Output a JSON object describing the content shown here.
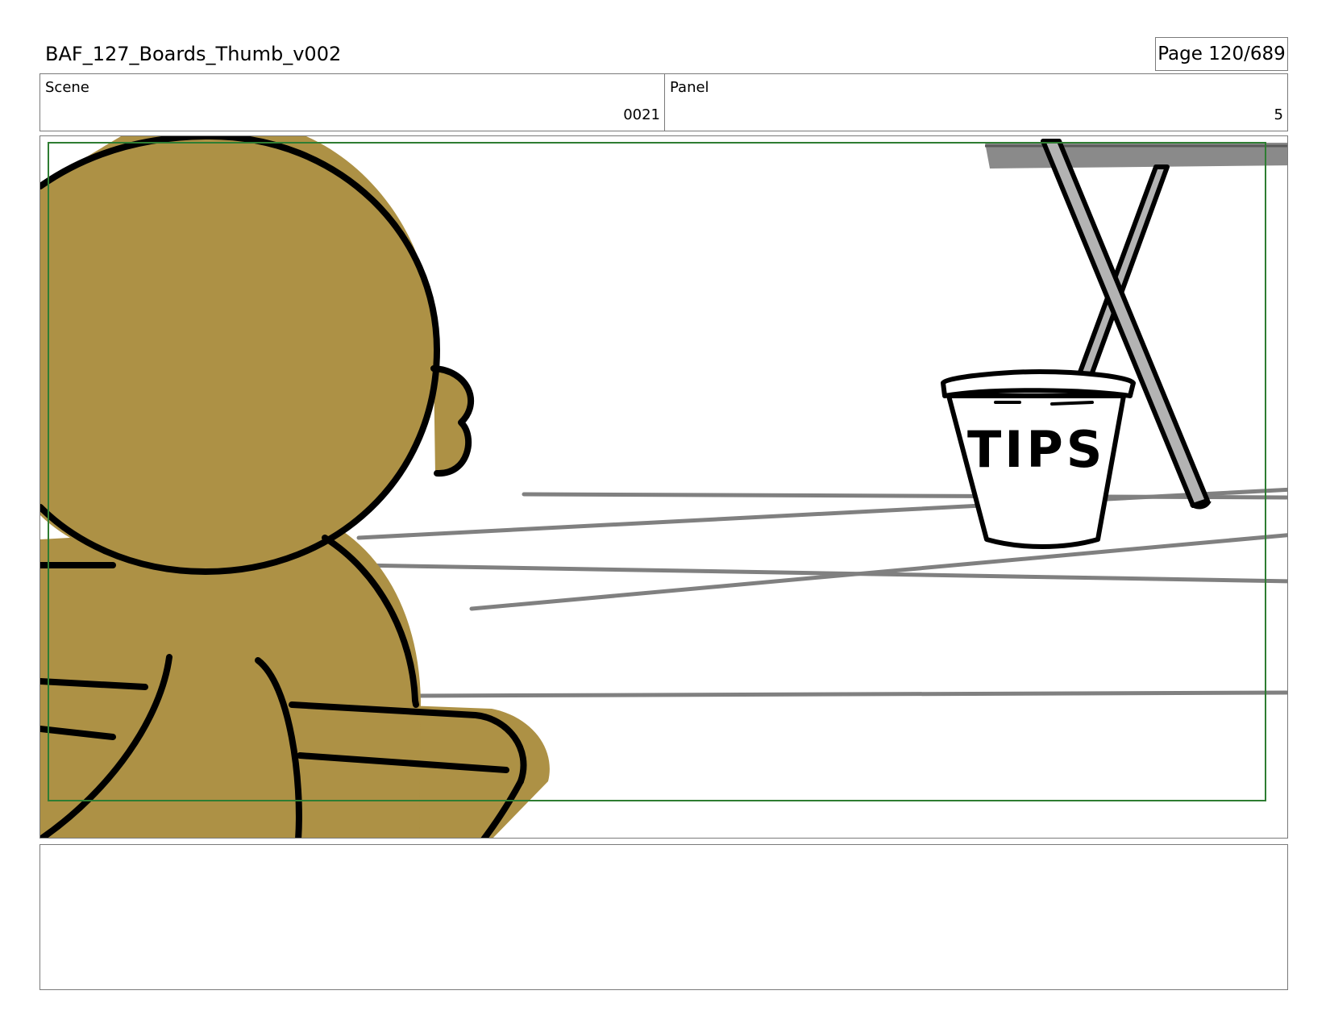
{
  "document": {
    "title": "BAF_127_Boards_Thumb_v002",
    "page_indicator": "Page 120/689"
  },
  "scene": {
    "label": "Scene",
    "value": "0021"
  },
  "panel": {
    "label": "Panel",
    "value": "5"
  },
  "artwork": {
    "bucket_text": "TIPS",
    "colors": {
      "character_fill": "#ad9145",
      "line_art": "#000000",
      "background_lines": "#808080",
      "stand_fill": "#b3b3b3",
      "safe_frame": "#2e7d32"
    }
  },
  "notes": {
    "text": ""
  }
}
